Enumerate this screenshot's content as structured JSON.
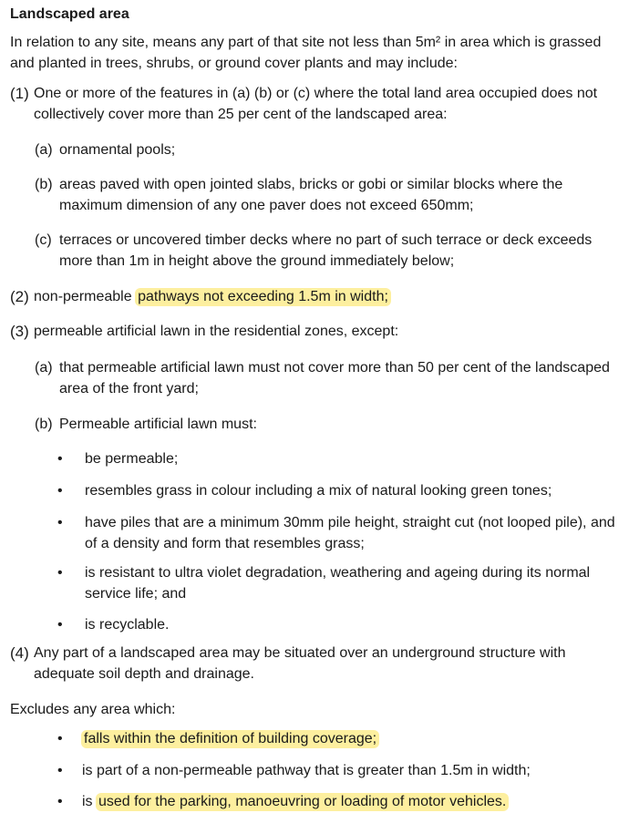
{
  "title": "Landscaped area",
  "intro": "In relation to any site, means any part of that site not less than 5m² in area which is grassed and planted in trees, shrubs, or ground cover plants and may include:",
  "items": [
    {
      "num": "(1)",
      "text": "One or more of the features in (a) (b) or (c) where the total land area occupied does not collectively cover more than 25 per cent of the landscaped area:",
      "subs": [
        {
          "label": "(a)",
          "text": "ornamental pools;"
        },
        {
          "label": "(b)",
          "text": "areas paved with open jointed slabs, bricks or gobi or similar blocks where the maximum dimension of any one paver does not exceed 650mm;"
        },
        {
          "label": "(c)",
          "text": "terraces or uncovered timber decks where no part of such terrace or deck exceeds more than 1m in height above the ground immediately below;"
        }
      ]
    },
    {
      "num": "(2)",
      "text_plain": "non-permeable ",
      "text_highlight": "pathways not exceeding 1.5m in width;"
    },
    {
      "num": "(3)",
      "text": "permeable artificial lawn in the residential zones, except:",
      "subs": [
        {
          "label": "(a)",
          "text": "that permeable artificial lawn must not cover more than 50 per cent of the landscaped area of the front yard;"
        },
        {
          "label": "(b)",
          "text": "Permeable artificial lawn must:"
        }
      ],
      "bullets": [
        "be permeable;",
        "resembles grass in colour including a mix of natural looking green tones;",
        "have piles that are a minimum 30mm pile height, straight cut (not looped pile), and of a density and form that resembles grass;",
        "is resistant to ultra violet degradation, weathering and ageing during its normal service life; and",
        "is recyclable."
      ]
    },
    {
      "num": "(4)",
      "text": "Any part of a landscaped area may be situated over an underground structure with adequate soil depth and drainage."
    }
  ],
  "excludes": {
    "heading": "Excludes any area which:",
    "bullet_1": "falls within the definition of building coverage;",
    "bullet_2": "is part of a non-permeable pathway that is greater than 1.5m in width;",
    "bullet_3_plain": "is ",
    "bullet_3_highlight": "used for the parking, manoeuvring or loading of motor vehicles."
  },
  "bullet_glyph": "•",
  "colors": {
    "highlight": "#fdef9f",
    "text": "#1a1a1a"
  }
}
